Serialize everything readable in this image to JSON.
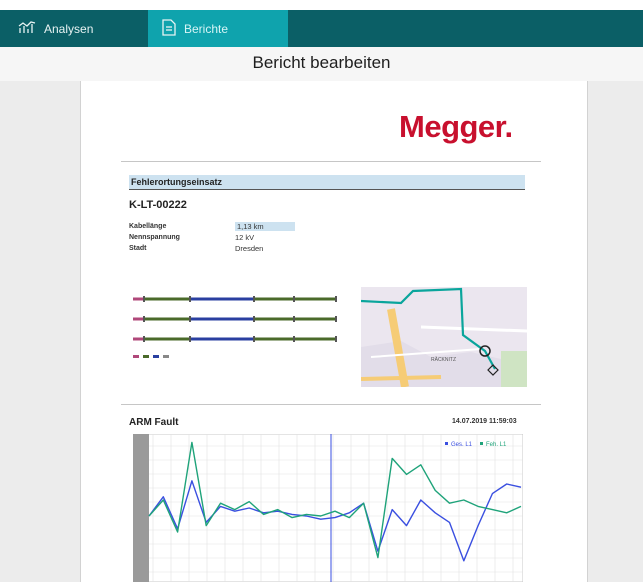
{
  "tabs": [
    {
      "label": "Analysen",
      "icon": "chart-bars-icon"
    },
    {
      "label": "Berichte",
      "icon": "document-icon"
    }
  ],
  "page_title": "Bericht bearbeiten",
  "report": {
    "logo_text": "Megger",
    "logo_dot": ".",
    "section_title": "Fehlerortungseinsatz",
    "cable_id": "K-LT-00222",
    "details": [
      {
        "label": "Kabellänge",
        "value": "1,13 km"
      },
      {
        "label": "Nennspannung",
        "value": "12 kV"
      },
      {
        "label": "Stadt",
        "value": "Dresden"
      }
    ],
    "map_label": "RÄCKNITZ",
    "arm": {
      "title": "ARM Fault",
      "datetime": "14.07.2019 11:59:03",
      "legend": [
        "Ges. L1",
        "Feh. L1"
      ]
    }
  },
  "colors": {
    "header": "#0b5f66",
    "active_tab": "#0fa3ad",
    "logo": "#c8102e",
    "section_fill": "#cde2f0",
    "trace_blue": "#3a4fe0",
    "trace_green": "#1fa37a"
  },
  "chart_data": {
    "type": "line",
    "title": "ARM Fault",
    "series": [
      {
        "name": "Ges. L1",
        "values": [
          0,
          12,
          -8,
          22,
          -4,
          6,
          3,
          5,
          2,
          3,
          1,
          0,
          -2,
          -1,
          2,
          8,
          -22,
          4,
          -6,
          10,
          2,
          -4,
          -28,
          -6,
          14,
          20,
          18
        ]
      },
      {
        "name": "Feh. L1",
        "values": [
          0,
          10,
          -10,
          46,
          -6,
          8,
          4,
          9,
          1,
          4,
          -1,
          1,
          0,
          3,
          -1,
          8,
          -26,
          36,
          26,
          32,
          16,
          8,
          10,
          6,
          4,
          2,
          6
        ]
      }
    ],
    "grid": true,
    "legend": "top-right"
  }
}
